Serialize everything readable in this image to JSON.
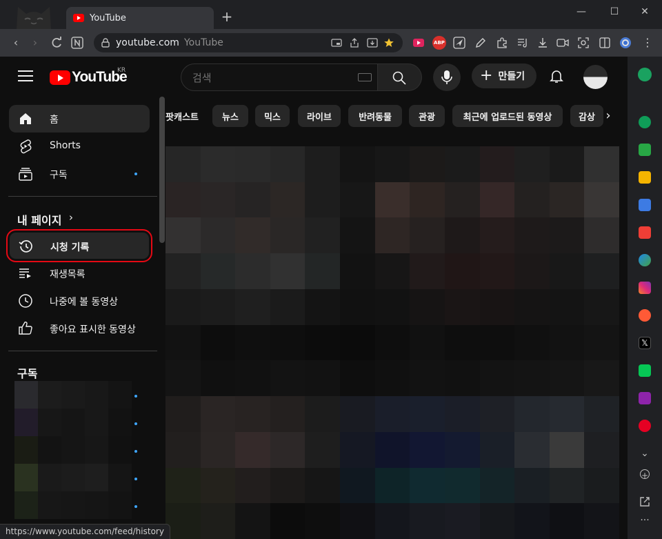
{
  "browser": {
    "tab_title": "YouTube",
    "new_tab": "+",
    "address": {
      "host": "youtube.com",
      "page_title": "YouTube"
    },
    "status_url": "https://www.youtube.com/feed/history",
    "extensions": [
      "youtube-ext-icon",
      "abp-icon",
      "send-icon",
      "pen-icon",
      "puzzle-icon",
      "music-note-icon",
      "download-icon",
      "video-camera-icon",
      "screenshot-icon",
      "split-view-icon",
      "profile-icon",
      "menu-dots-icon"
    ],
    "abp_label": "ABP"
  },
  "youtube": {
    "logo_text": "YouTube",
    "country": "KR",
    "search": {
      "placeholder": "검색"
    },
    "create_label": "만들기",
    "chips": [
      "팟캐스트",
      "뉴스",
      "믹스",
      "라이브",
      "반려동물",
      "관광",
      "최근에 업로드된 동영상",
      "감상"
    ],
    "guide": {
      "main": [
        {
          "label": "홈",
          "icon": "home-icon",
          "active": true
        },
        {
          "label": "Shorts",
          "icon": "shorts-icon"
        },
        {
          "label": "구독",
          "icon": "subscriptions-icon",
          "dot": true
        }
      ],
      "you_section": "내 페이지",
      "you_chevron": "›",
      "you": [
        {
          "label": "시청 기록",
          "icon": "history-icon",
          "highlighted": true
        },
        {
          "label": "재생목록",
          "icon": "playlist-icon"
        },
        {
          "label": "나중에 볼 동영상",
          "icon": "watch-later-icon"
        },
        {
          "label": "좋아요 표시한 동영상",
          "icon": "like-icon"
        }
      ],
      "subscriptions_section": "구독"
    }
  },
  "colors": {
    "highlight_border": "#e50914",
    "accent_dot": "#3ea6ff",
    "yt_red": "#ff0000"
  }
}
